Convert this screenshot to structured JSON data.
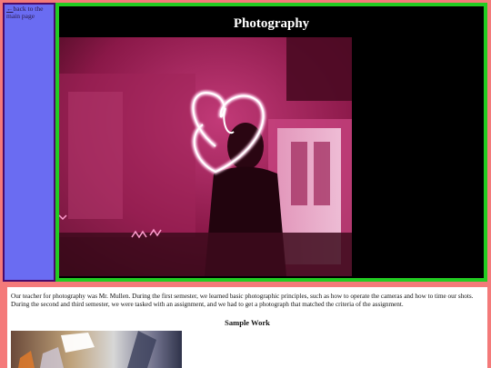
{
  "nav": {
    "back_arrow": "←",
    "back_label": "back to the main page"
  },
  "header": {
    "title": "Photography"
  },
  "hero": {
    "icon": "light-painting-photo"
  },
  "content": {
    "description": "Our teacher for photography was Mr. Mullen. During the first semester, we learned basic photographic principles, such as how to operate the cameras and how to time our shots. During the second and third semester, we were tasked with an assignment, and we had to get a photograph that matched the criteria of the assignment.",
    "sample_heading": "Sample Work"
  },
  "colors": {
    "page_bg": "#f47a7a",
    "sidebar_bg": "#6a6cf2",
    "sidebar_border": "#4a0a6a",
    "main_bg": "#000000",
    "main_border": "#22cc22",
    "hero_tint": "#b0205f"
  }
}
